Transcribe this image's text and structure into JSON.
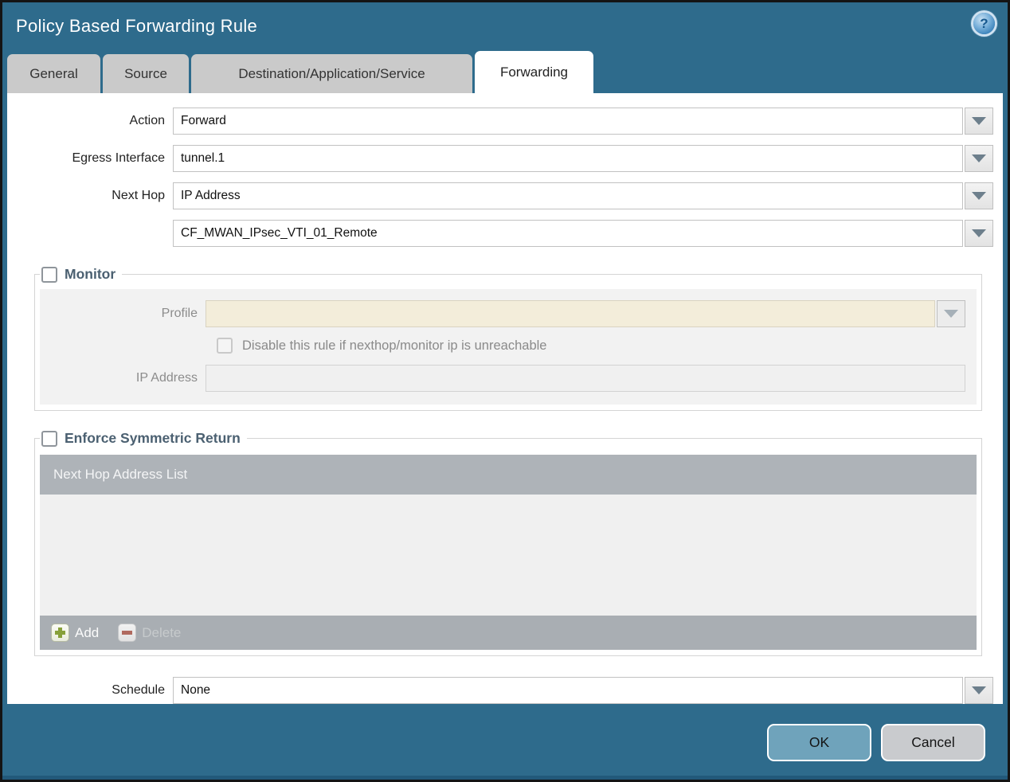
{
  "dialog": {
    "title": "Policy Based Forwarding Rule"
  },
  "tabs": [
    {
      "label": "General",
      "active": false
    },
    {
      "label": "Source",
      "active": false
    },
    {
      "label": "Destination/Application/Service",
      "active": false
    },
    {
      "label": "Forwarding",
      "active": true
    }
  ],
  "form": {
    "action": {
      "label": "Action",
      "value": "Forward"
    },
    "egress_interface": {
      "label": "Egress Interface",
      "value": "tunnel.1"
    },
    "next_hop": {
      "label": "Next Hop",
      "value": "IP Address"
    },
    "next_hop_address": {
      "value": "CF_MWAN_IPsec_VTI_01_Remote"
    },
    "schedule": {
      "label": "Schedule",
      "value": "None"
    }
  },
  "monitor": {
    "legend": "Monitor",
    "checked": false,
    "profile": {
      "label": "Profile",
      "value": ""
    },
    "disable_rule_label": "Disable this rule if nexthop/monitor ip is unreachable",
    "disable_rule_checked": false,
    "ip_address": {
      "label": "IP Address",
      "value": ""
    }
  },
  "symmetric_return": {
    "legend": "Enforce Symmetric Return",
    "checked": false,
    "table_header": "Next Hop Address List",
    "rows": [],
    "add_label": "Add",
    "delete_label": "Delete",
    "delete_enabled": false
  },
  "footer": {
    "ok_label": "OK",
    "cancel_label": "Cancel"
  },
  "icons": {
    "help": "help-icon",
    "dropdown": "chevron-down-icon",
    "add": "plus-icon",
    "delete": "minus-icon"
  },
  "colors": {
    "frame_teal": "#2e6b8c",
    "frame_teal_dark": "#22597a",
    "tab_inactive": "#cacaca",
    "legend_text": "#4b6071",
    "disabled_field_cream": "#f3edda",
    "panel_gray": "#f2f2f2",
    "table_header_bg": "#aeb3b8",
    "table_footer_bg": "#a9aeb3",
    "ok_button_bg": "#6fa3bb",
    "cancel_button_bg": "#c9cbce",
    "add_plus_green": "#87a039",
    "delete_minus_red": "#b06a5f"
  }
}
